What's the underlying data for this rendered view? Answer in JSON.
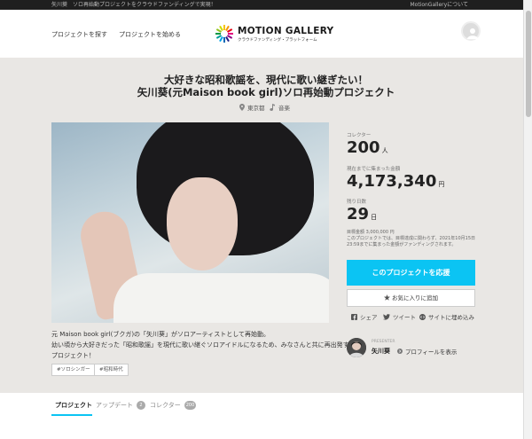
{
  "topbar": {
    "left_text": "矢川葵　ソロ再始動プロジェクトをクラウドファンディングで実現！",
    "right_text": "MotionGalleryについて"
  },
  "header": {
    "nav": [
      "プロジェクトを探す",
      "プロジェクトを始める"
    ],
    "logo_name": "MOTION GALLERY",
    "logo_tagline": "クラウドファンディング・プラットフォーム"
  },
  "project": {
    "title_line1": "大好きな昭和歌謡を、現代に歌い継ぎたい！",
    "title_line2": "矢川葵(元Maison book girl)ソロ再始動プロジェクト",
    "location": "東京都",
    "category": "音楽"
  },
  "stats": {
    "collectors_label": "コレクター",
    "collectors_value": "200",
    "collectors_unit": "人",
    "raised_label": "現在までに集まった金額",
    "raised_value": "4,173,340",
    "raised_unit": "円",
    "days_label": "残り日数",
    "days_value": "29",
    "days_unit": "日",
    "goal_text": "目標金額 3,000,000 円",
    "note_text": "このプロジェクトでは、目標達成に関わらず、2021年10月15日23:59までに集まった金額がファンディングされます。"
  },
  "actions": {
    "support_label": "このプロジェクトを応援",
    "favorite_label": "お気に入りに追加",
    "share_facebook": "シェア",
    "share_tweet": "ツイート",
    "share_embed": "サイトに埋め込み"
  },
  "description": {
    "line1": "元 Maison book girl(ブクガ)の「矢川葵」がソロアーティストとして再始動。",
    "line2": "幼い頃から大好きだった「昭和歌謡」を現代に歌い継ぐソロアイドルになるため、みなさんと共に再出発する",
    "line3": "プロジェクト！",
    "tags": [
      "#ソロシンガー",
      "#昭和時代"
    ]
  },
  "presenter": {
    "label": "PRESENTER",
    "name": "矢川葵",
    "profile_link": "プロフィールを表示"
  },
  "tabs": [
    {
      "label": "プロジェクト",
      "badge": ""
    },
    {
      "label": "アップデート",
      "badge": "2"
    },
    {
      "label": "コレクター",
      "badge": "200"
    }
  ],
  "colors": {
    "accent": "#0bc4f3",
    "page_bg": "#e9e7e4"
  }
}
